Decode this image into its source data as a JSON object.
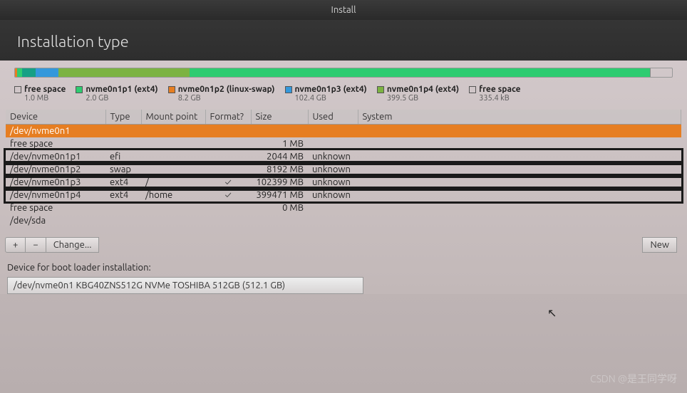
{
  "titlebar": {
    "title": "Install"
  },
  "header": {
    "title": "Installation type"
  },
  "usage_bar": [
    {
      "cls": "seg-orange",
      "pct": 0.3
    },
    {
      "cls": "seg-green",
      "pct": 0.8
    },
    {
      "cls": "seg-teal",
      "pct": 2.0
    },
    {
      "cls": "seg-blue",
      "pct": 3.5
    },
    {
      "cls": "seg-lime",
      "pct": 20.0
    },
    {
      "cls": "seg-green",
      "pct": 70.0
    },
    {
      "cls": "seg-gray",
      "pct": 0.2
    }
  ],
  "legend": [
    {
      "swatch": "empty",
      "label": "free space",
      "sub": "1.0 MB"
    },
    {
      "swatch": "sw-green",
      "label": "nvme0n1p1 (ext4)",
      "sub": "2.0 GB"
    },
    {
      "swatch": "sw-orange",
      "label": "nvme0n1p2 (linux-swap)",
      "sub": "8.2 GB"
    },
    {
      "swatch": "sw-blue",
      "label": "nvme0n1p3 (ext4)",
      "sub": "102.4 GB"
    },
    {
      "swatch": "sw-lime",
      "label": "nvme0n1p4 (ext4)",
      "sub": "399.5 GB"
    },
    {
      "swatch": "empty",
      "label": "free space",
      "sub": "335.4 kB"
    }
  ],
  "columns": {
    "device": "Device",
    "type": "Type",
    "mount": "Mount point",
    "format": "Format?",
    "size": "Size",
    "used": "Used",
    "system": "System"
  },
  "rows": [
    {
      "device": "/dev/nvme0n1",
      "selected": true
    },
    {
      "device": "free space",
      "size": "1 MB"
    },
    {
      "device": "/dev/nvme0n1p1",
      "type": "efi",
      "size": "2044 MB",
      "used": "unknown",
      "hl": true
    },
    {
      "device": "/dev/nvme0n1p2",
      "type": "swap",
      "size": "8192 MB",
      "used": "unknown",
      "hl": true
    },
    {
      "device": "/dev/nvme0n1p3",
      "type": "ext4",
      "mount": "/",
      "format": "✓",
      "size": "102399 MB",
      "used": "unknown",
      "hl": true
    },
    {
      "device": "/dev/nvme0n1p4",
      "type": "ext4",
      "mount": "/home",
      "format": "✓",
      "size": "399471 MB",
      "used": "unknown",
      "hl": true
    },
    {
      "device": "free space",
      "size": "0 MB"
    },
    {
      "device": "/dev/sda"
    }
  ],
  "toolbar": {
    "add": "+",
    "remove": "−",
    "change": "Change...",
    "new_table": "New"
  },
  "bootloader": {
    "label": "Device for boot loader installation:",
    "value": "/dev/nvme0n1    KBG40ZNS512G NVMe TOSHIBA 512GB (512.1 GB)"
  },
  "watermark": "CSDN @是王同学呀"
}
